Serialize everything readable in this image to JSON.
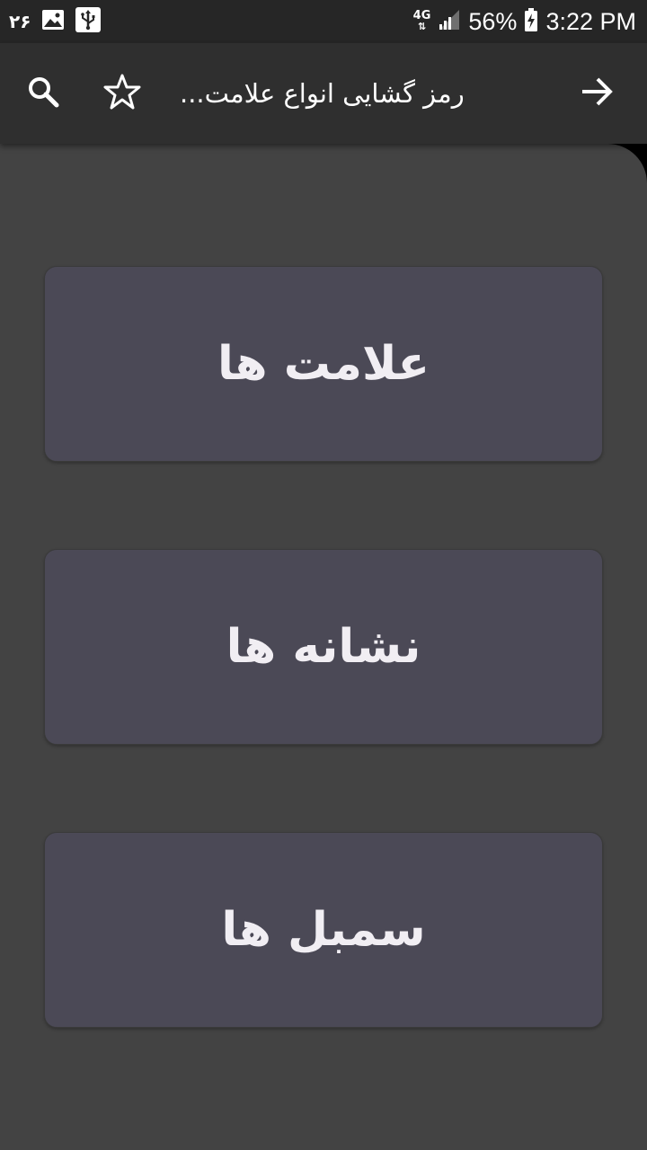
{
  "status_bar": {
    "notification_count": "۲۶",
    "network_label": "4G",
    "battery_percent": "56%",
    "time": "3:22 PM",
    "icons": [
      "image-icon",
      "usb-icon",
      "signal-icon",
      "battery-charging-icon"
    ]
  },
  "app_bar": {
    "title": "رمز گشایی انواع علامت...",
    "icons": [
      "search-icon",
      "star-icon",
      "arrow-forward-icon"
    ]
  },
  "menu": {
    "items": [
      {
        "label": "علامت ها"
      },
      {
        "label": "نشانه ها"
      },
      {
        "label": "سمبل ها"
      }
    ]
  },
  "colors": {
    "status_bar_bg": "#262626",
    "app_bar_bg": "#2f2f2f",
    "content_bg": "#434343",
    "card_bg": "#4b4956",
    "card_text": "#f1eef3"
  }
}
